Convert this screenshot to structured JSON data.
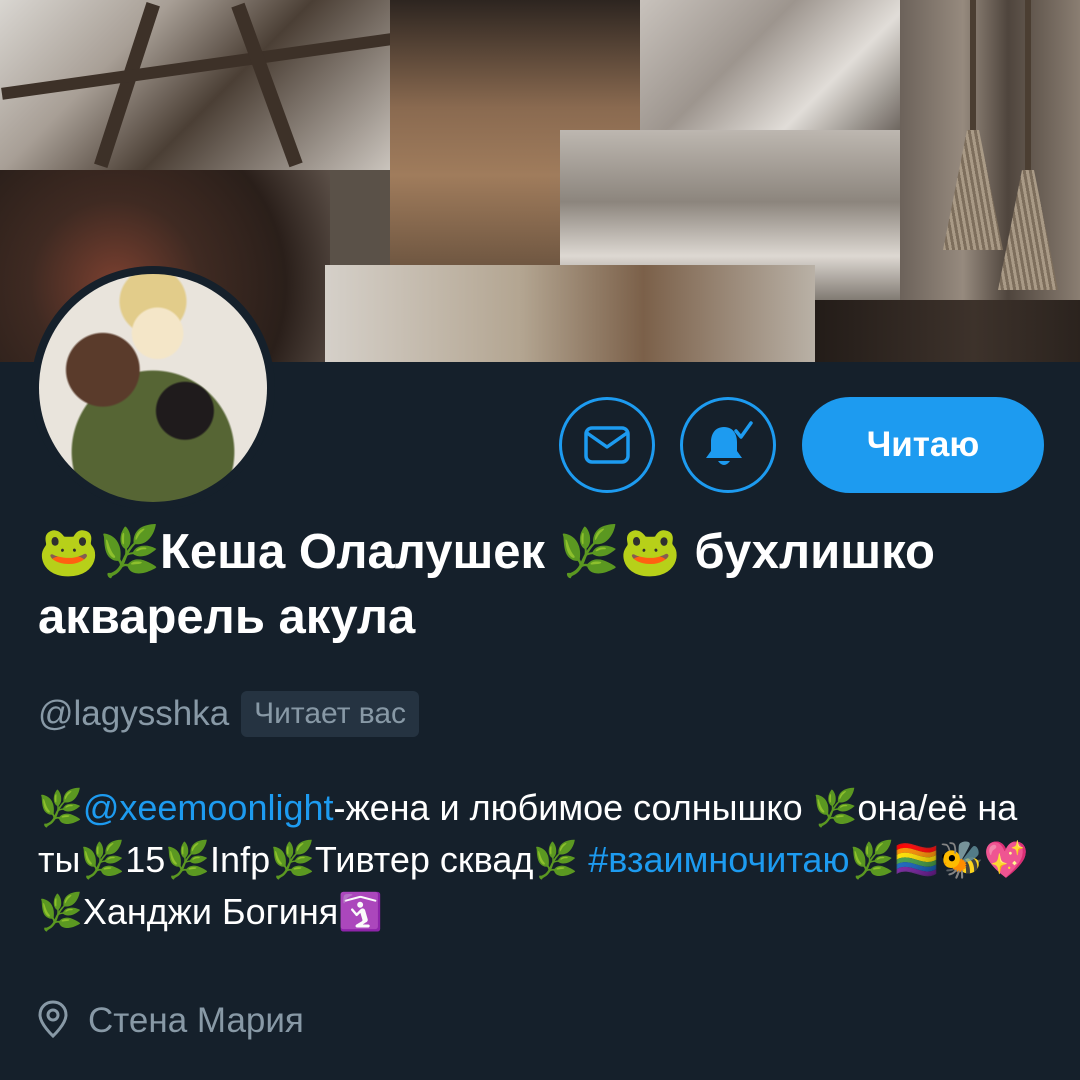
{
  "profile": {
    "display_name": "🐸🌿Кеша Олалушек 🌿🐸 бухлишко акварель акула",
    "handle": "@lagysshka",
    "follows_you_label": "Читает вас",
    "bio": {
      "prefix": "🌿",
      "mention": "@xeemoonlight",
      "after_mention": "-жена и любимое солнышко 🌿она/её на ты🌿15🌿Infp🌿Тивтер сквад🌿 ",
      "hashtag": "#взаимночитаю",
      "tail": "🌿🏳️‍🌈🐝💖 🌿Ханджи Богиня🛐"
    },
    "location": "Стена Мария"
  },
  "actions": {
    "message_icon": "envelope-icon",
    "notifications_icon": "bell-check-icon",
    "follow_label": "Читаю"
  },
  "colors": {
    "background": "#15202b",
    "accent": "#1d9bf0",
    "secondary_text": "#8899a6",
    "badge_bg": "#253341"
  }
}
